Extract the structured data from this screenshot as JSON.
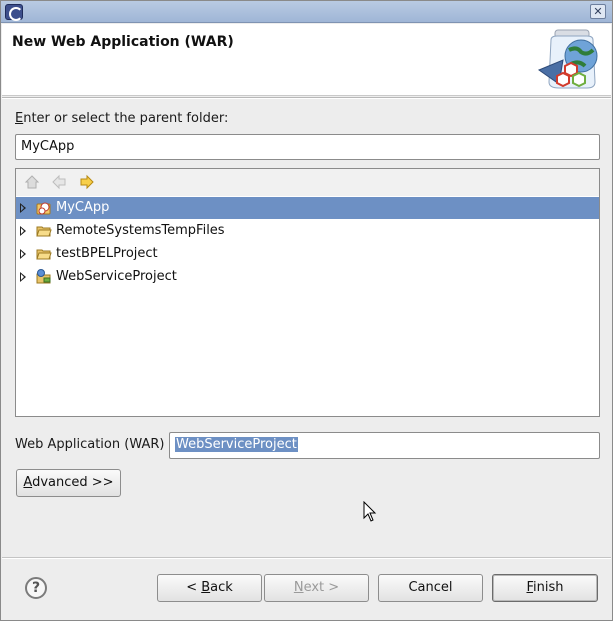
{
  "window": {
    "title": "",
    "close_glyph": "✕"
  },
  "header": {
    "title": "New Web Application (WAR)"
  },
  "parent_folder": {
    "label_underlined_char": "E",
    "label_rest": "nter or select the parent folder:",
    "value": "MyCApp"
  },
  "tree_toolbar": {
    "home_icon": "home-icon",
    "back_icon": "back-arrow-icon",
    "forward_icon": "forward-arrow-icon"
  },
  "tree": {
    "items": [
      {
        "label": "MyCApp",
        "icon": "capp-project-icon",
        "selected": true
      },
      {
        "label": "RemoteSystemsTempFiles",
        "icon": "open-folder-icon",
        "selected": false
      },
      {
        "label": "testBPELProject",
        "icon": "open-folder-icon",
        "selected": false
      },
      {
        "label": "WebServiceProject",
        "icon": "web-service-project-icon",
        "selected": false
      }
    ]
  },
  "war_name": {
    "label": "Web Application (WAR)",
    "value": "WebServiceProject"
  },
  "buttons": {
    "advanced_underlined": "A",
    "advanced_rest": "dvanced >>",
    "back_prefix": "< ",
    "back_underlined": "B",
    "back_rest": "ack",
    "next_underlined": "N",
    "next_rest": "ext >",
    "cancel": "Cancel",
    "finish_underlined": "F",
    "finish_rest": "inish",
    "help_glyph": "?"
  },
  "colors": {
    "selection": "#6d90c4",
    "title_bar": "#a9bedc"
  }
}
